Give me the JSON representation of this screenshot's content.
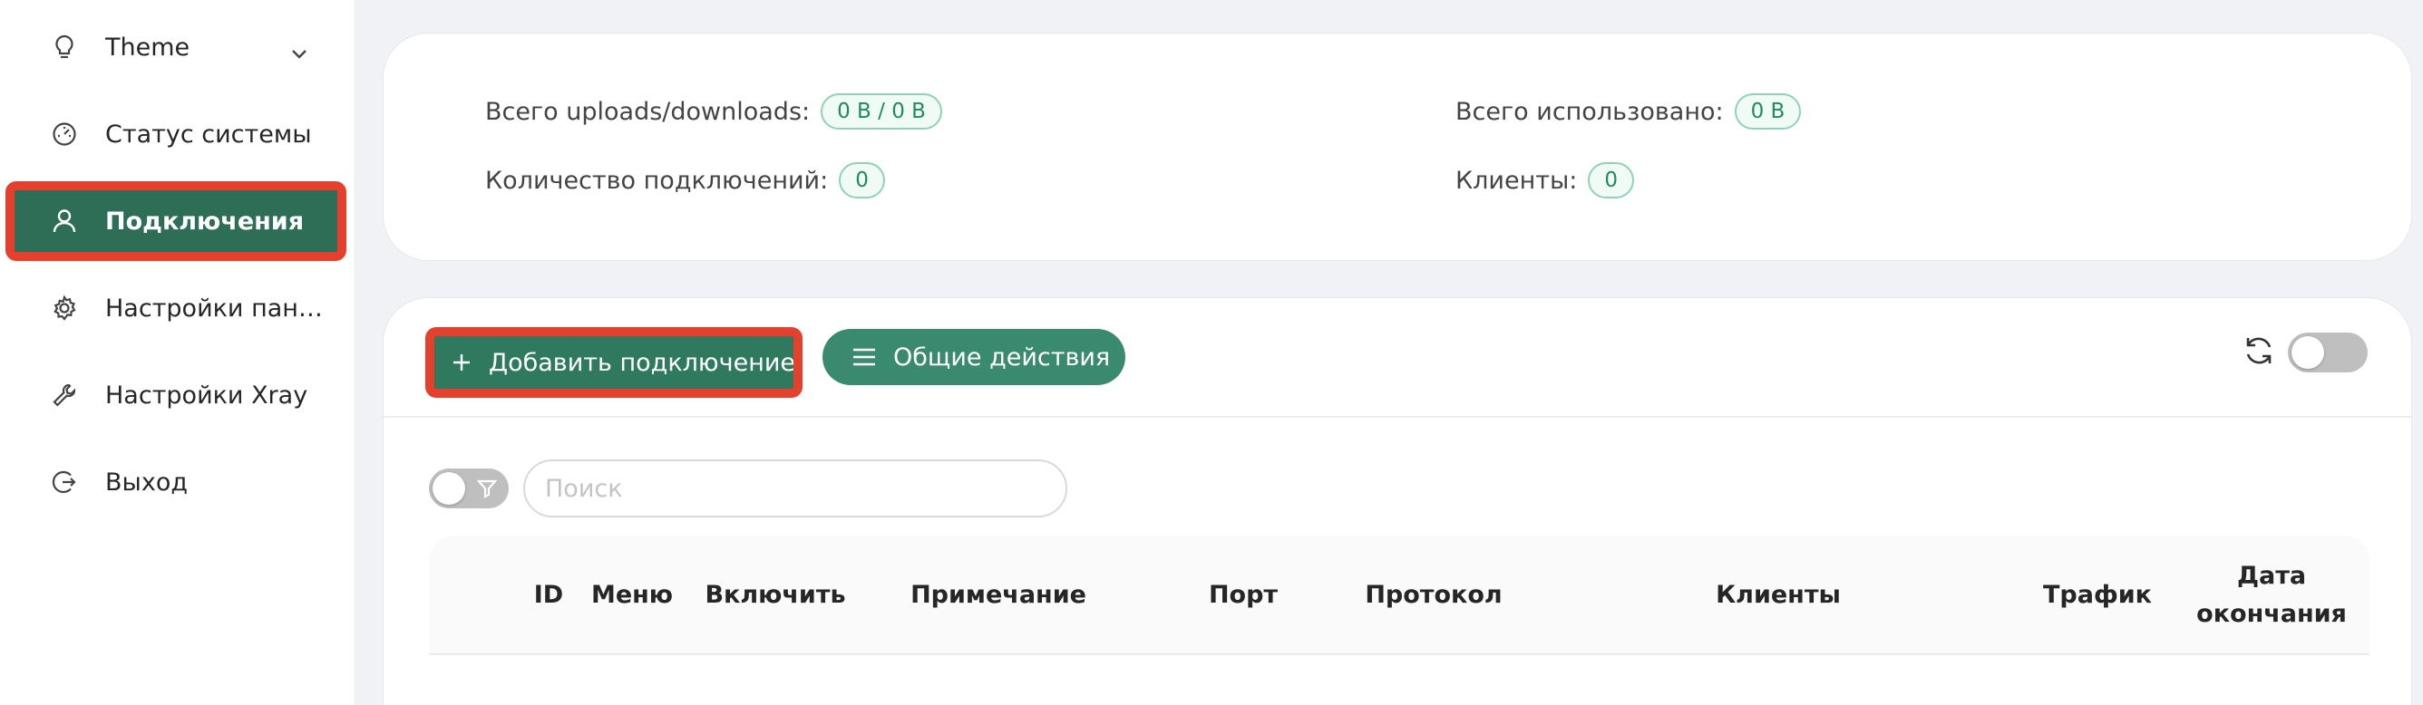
{
  "sidebar": {
    "items": [
      {
        "label": "Theme",
        "icon": "lightbulb-icon",
        "has_dropdown": true
      },
      {
        "label": "Статус системы",
        "icon": "dashboard-icon"
      },
      {
        "label": "Подключения",
        "icon": "user-icon",
        "active": true
      },
      {
        "label": "Настройки панели",
        "icon": "gear-icon"
      },
      {
        "label": "Настройки Xray",
        "icon": "tool-icon"
      },
      {
        "label": "Выход",
        "icon": "logout-icon"
      }
    ]
  },
  "stats": {
    "uploads_downloads_label": "Всего uploads/downloads:",
    "uploads_downloads_value": "0 B / 0 B",
    "used_label": "Всего использовано:",
    "used_value": "0 B",
    "connections_label": "Количество подключений:",
    "connections_value": "0",
    "clients_label": "Клиенты:",
    "clients_value": "0"
  },
  "toolbar": {
    "add_label": "Добавить подключение",
    "general_label": "Общие действия"
  },
  "search": {
    "placeholder": "Поиск",
    "value": ""
  },
  "table": {
    "columns": [
      "ID",
      "Меню",
      "Включить",
      "Примечание",
      "Порт",
      "Протокол",
      "Клиенты",
      "Трафик",
      "Дата окончания"
    ]
  },
  "colors": {
    "accent": "#3a8a6f",
    "active_menu": "#2e6e57",
    "highlight_border": "#e5402d",
    "tag_text": "#1e8c60"
  }
}
